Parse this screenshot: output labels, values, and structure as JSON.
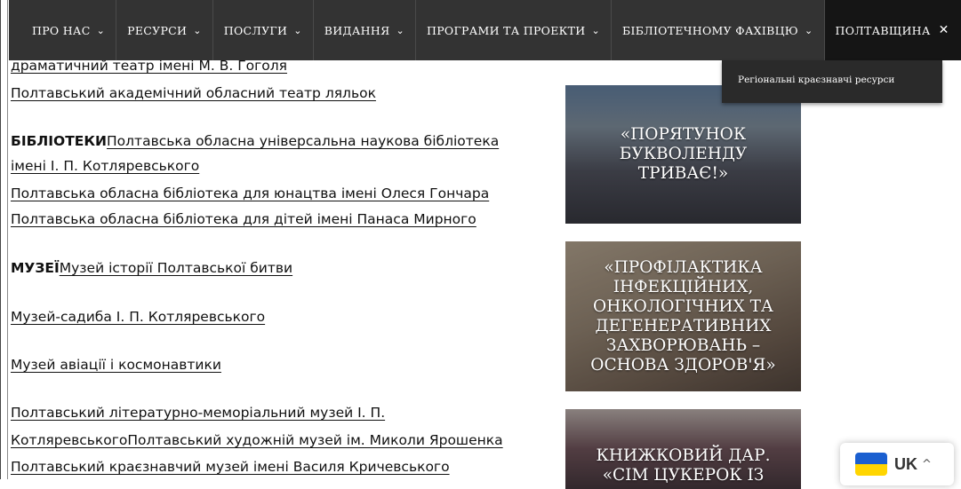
{
  "nav": {
    "items": [
      {
        "label": "ПРО НАС",
        "chevron": "⌄"
      },
      {
        "label": "РЕСУРСИ",
        "chevron": "⌄"
      },
      {
        "label": "ПОСЛУГИ",
        "chevron": "⌄"
      },
      {
        "label": "ВИДАННЯ",
        "chevron": "⌄"
      },
      {
        "label": "ПРОГРАМИ ТА ПРОЕКТИ",
        "chevron": "⌄"
      },
      {
        "label": "БІБЛІОТЕЧНОМУ ФАХІВЦЮ",
        "chevron": "⌄"
      }
    ],
    "active": {
      "label": "ПОЛТАВЩИНА",
      "close": "✕"
    },
    "dropdown_item": "Регіональні краєзнавчі ресурси"
  },
  "content": {
    "line_top": "драматичний театр імені М. В. Гоголя",
    "puppet_theatre": "Полтавський академічний обласний театр ляльок",
    "libraries_heading": "БІБЛІОТЕКИ",
    "lib1_part1": "Полтавська обласна універсальна наукова бібліотека",
    "lib1_part2": "імені І. П. Котляревського",
    "lib2": "Полтавська обласна бібліотека для юнацтва імені Олеся Гончара",
    "lib3": "Полтавська обласна бібліотека для дітей імені Панаса Мирного",
    "museums_heading": "МУЗЕЇ",
    "museum1": "Музей історії Полтавської битви",
    "museum2": "Музей-садиба І. П. Котляревського",
    "museum3": "Музей авіації і космонавтики",
    "museum4_part1": "Полтавський літературно-меморіальний музей І. П.",
    "museum4_part2": "Котляревського",
    "museum5": "Полтавський художній музей ім. Миколи Ярошенка",
    "museum6": "Полтавський краєзнавчий музей імені Василя Кричевського"
  },
  "cards": [
    {
      "title": "«ПОРЯТУНОК БУКВОЛЕНДУ ТРИВАЄ!»"
    },
    {
      "title": "«ПРОФІЛАКТИКА ІНФЕКЦІЙНИХ, ОНКОЛОГІЧНИХ ТА ДЕГЕНЕРАТИВНИХ ЗАХВОРЮВАНЬ – ОСНОВА ЗДОРОВ'Я»"
    },
    {
      "title": "КНИЖКОВИЙ ДАР. «СІМ ЦУКЕРОК ІЗ"
    }
  ],
  "language": {
    "code": "UK",
    "caret": "^",
    "flag_colors": [
      "#1a5fd0",
      "#ffd500"
    ]
  }
}
